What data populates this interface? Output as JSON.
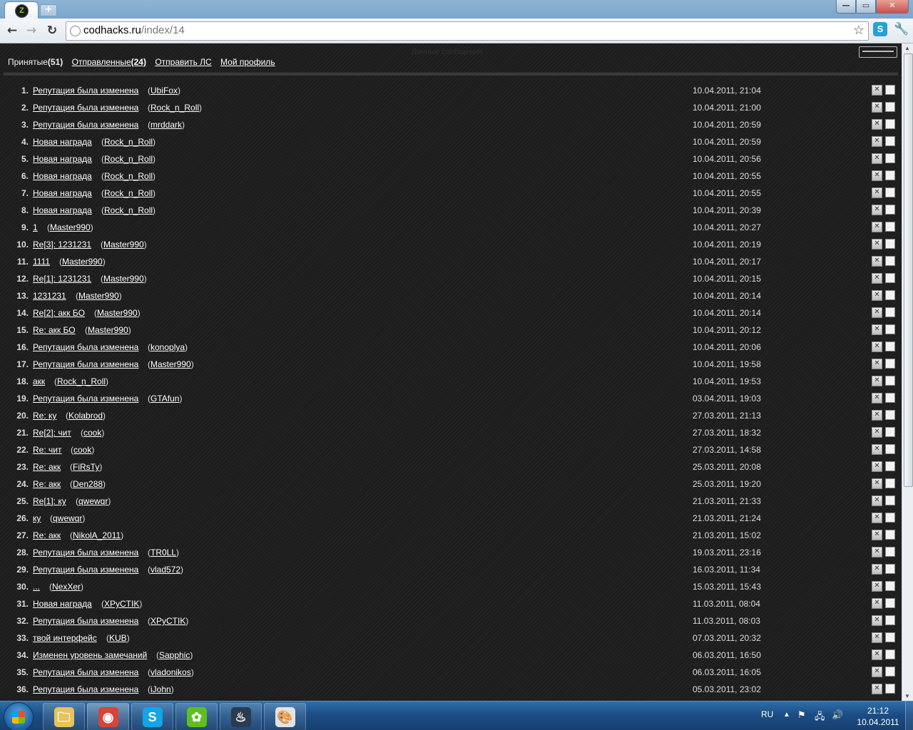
{
  "browser": {
    "tab_logo": "Z",
    "new_tab_label": "+",
    "window_buttons": {
      "minimize": "—",
      "maximize": "▭",
      "close": "✕"
    },
    "nav": {
      "back": "←",
      "forward": "→",
      "reload": "↻"
    },
    "url_host": "codhacks.ru",
    "url_path": "/index/14",
    "star": "☆",
    "skype_ext": "S",
    "wrench": "🔧",
    "icons": {
      "back": "arrow-left-icon",
      "forward": "arrow-right-icon",
      "reload": "reload-icon",
      "page": "globe-icon",
      "bookmark": "star-icon",
      "settings": "wrench-icon"
    }
  },
  "pm": {
    "nav": {
      "received_label": "Принятые",
      "received_count": "(51)",
      "sent_label": "Отправленные",
      "sent_count": "(24)",
      "send_label": "Отправить ЛС",
      "profile_label": "Мой профиль"
    },
    "faint_text": "Личные сообщения",
    "messages": [
      {
        "n": "1.",
        "subject": "Репутация была изменена",
        "author": "UbiFox",
        "date": "10.04.2011, 21:04"
      },
      {
        "n": "2.",
        "subject": "Репутация была изменена",
        "author": "Rock_n_Roll",
        "date": "10.04.2011, 21:00"
      },
      {
        "n": "3.",
        "subject": "Репутация была изменена",
        "author": "mrddark",
        "date": "10.04.2011, 20:59"
      },
      {
        "n": "4.",
        "subject": "Новая награда",
        "author": "Rock_n_Roll",
        "date": "10.04.2011, 20:59"
      },
      {
        "n": "5.",
        "subject": "Новая награда",
        "author": "Rock_n_Roll",
        "date": "10.04.2011, 20:56"
      },
      {
        "n": "6.",
        "subject": "Новая награда",
        "author": "Rock_n_Roll",
        "date": "10.04.2011, 20:55"
      },
      {
        "n": "7.",
        "subject": "Новая награда",
        "author": "Rock_n_Roll",
        "date": "10.04.2011, 20:55"
      },
      {
        "n": "8.",
        "subject": "Новая награда",
        "author": "Rock_n_Roll",
        "date": "10.04.2011, 20:39"
      },
      {
        "n": "9.",
        "subject": "1",
        "author": "Master990",
        "date": "10.04.2011, 20:27"
      },
      {
        "n": "10.",
        "subject": "Re[3]: 1231231",
        "author": "Master990",
        "date": "10.04.2011, 20:19"
      },
      {
        "n": "11.",
        "subject": "1111",
        "author": "Master990",
        "date": "10.04.2011, 20:17"
      },
      {
        "n": "12.",
        "subject": "Re[1]: 1231231",
        "author": "Master990",
        "date": "10.04.2011, 20:15"
      },
      {
        "n": "13.",
        "subject": "1231231",
        "author": "Master990",
        "date": "10.04.2011, 20:14"
      },
      {
        "n": "14.",
        "subject": "Re[2]: акк БО",
        "author": "Master990",
        "date": "10.04.2011, 20:14"
      },
      {
        "n": "15.",
        "subject": "Re: акк БО",
        "author": "Master990",
        "date": "10.04.2011, 20:12"
      },
      {
        "n": "16.",
        "subject": "Репутация была изменена",
        "author": "konoplya",
        "date": "10.04.2011, 20:06"
      },
      {
        "n": "17.",
        "subject": "Репутация была изменена",
        "author": "Master990",
        "date": "10.04.2011, 19:58"
      },
      {
        "n": "18.",
        "subject": "акк",
        "author": "Rock_n_Roll",
        "date": "10.04.2011, 19:53"
      },
      {
        "n": "19.",
        "subject": "Репутация была изменена",
        "author": "GTAfun",
        "date": "03.04.2011, 19:03"
      },
      {
        "n": "20.",
        "subject": "Re: ку",
        "author": "Kolabrod",
        "date": "27.03.2011, 21:13"
      },
      {
        "n": "21.",
        "subject": "Re[2]: чит",
        "author": "cook",
        "date": "27.03.2011, 18:32"
      },
      {
        "n": "22.",
        "subject": "Re: чит",
        "author": "cook",
        "date": "27.03.2011, 14:58"
      },
      {
        "n": "23.",
        "subject": "Re: акк",
        "author": "FiRsTy",
        "date": "25.03.2011, 20:08"
      },
      {
        "n": "24.",
        "subject": "Re: акк",
        "author": "Den288",
        "date": "25.03.2011, 19:20"
      },
      {
        "n": "25.",
        "subject": "Re[1]: ку",
        "author": "qwewqr",
        "date": "21.03.2011, 21:33"
      },
      {
        "n": "26.",
        "subject": "ку",
        "author": "qwewqr",
        "date": "21.03.2011, 21:24"
      },
      {
        "n": "27.",
        "subject": "Re: акк",
        "author": "NikolA_2011",
        "date": "21.03.2011, 15:02"
      },
      {
        "n": "28.",
        "subject": "Репутация была изменена",
        "author": "TR0LL",
        "date": "19.03.2011, 23:16"
      },
      {
        "n": "29.",
        "subject": "Репутация была изменена",
        "author": "vlad572",
        "date": "16.03.2011, 11:34"
      },
      {
        "n": "30.",
        "subject": "...",
        "author": "NexXer",
        "date": "15.03.2011, 15:43"
      },
      {
        "n": "31.",
        "subject": "Новая награда",
        "author": "XPyCTIK",
        "date": "11.03.2011, 08:04"
      },
      {
        "n": "32.",
        "subject": "Репутация была изменена",
        "author": "XPyCTIK",
        "date": "11.03.2011, 08:03"
      },
      {
        "n": "33.",
        "subject": "твой интерфейс",
        "author": "KUB",
        "date": "07.03.2011, 20:32"
      },
      {
        "n": "34.",
        "subject": "Изменен уровень замечаний",
        "author": "Sapphic",
        "date": "06.03.2011, 16:50"
      },
      {
        "n": "35.",
        "subject": "Репутация была изменена",
        "author": "vladonikos",
        "date": "06.03.2011, 16:05"
      },
      {
        "n": "36.",
        "subject": "Репутация была изменена",
        "author": "iJohn",
        "date": "05.03.2011, 23:02"
      }
    ],
    "delete_glyph": "✕"
  },
  "taskbar": {
    "apps": [
      {
        "name": "explorer",
        "glyph": "🗀",
        "color": "#e8c25a",
        "active": false
      },
      {
        "name": "chrome",
        "glyph": "◉",
        "color": "#d9443a",
        "active": true
      },
      {
        "name": "skype",
        "glyph": "S",
        "color": "#12a5e7",
        "active": false
      },
      {
        "name": "icq",
        "glyph": "✿",
        "color": "#5fbf1f",
        "active": false
      },
      {
        "name": "steam",
        "glyph": "♨",
        "color": "#2a3b52",
        "active": false
      },
      {
        "name": "paint",
        "glyph": "🎨",
        "color": "#e3e3e3",
        "active": false
      }
    ],
    "lang": "RU",
    "tray_arrow": "▲",
    "tray_icons": [
      "⚑",
      "🖧",
      "🔊"
    ],
    "time": "21:12",
    "date": "10.04.2011"
  }
}
